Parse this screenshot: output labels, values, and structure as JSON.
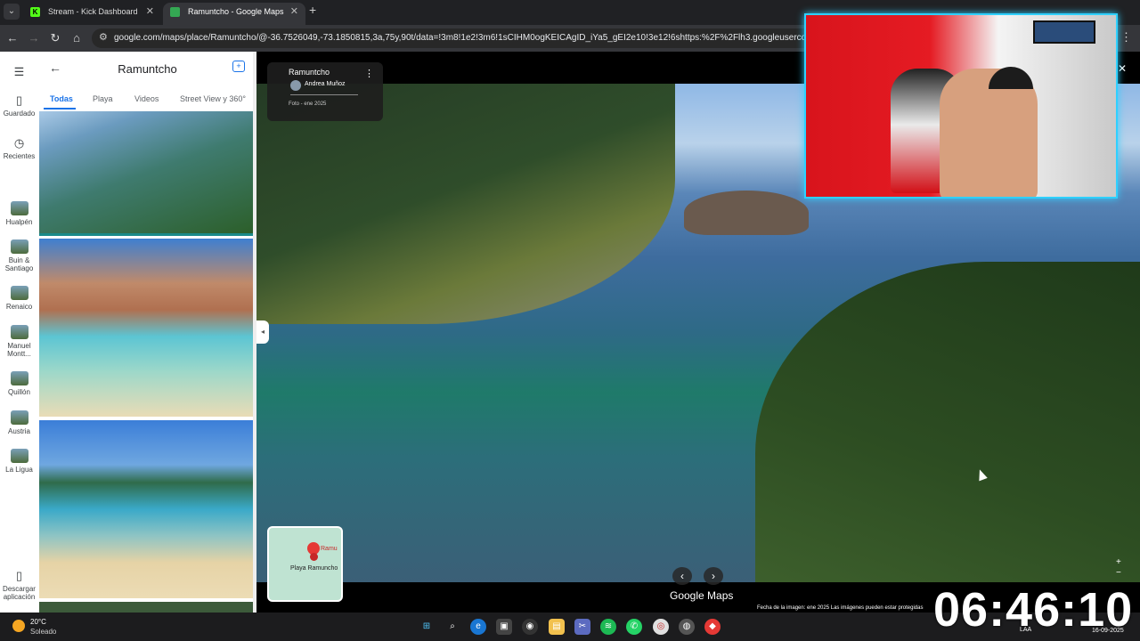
{
  "browser": {
    "tabs": [
      {
        "title": "Stream - Kick Dashboard",
        "favicon": "K"
      },
      {
        "title": "Ramuntcho - Google Maps",
        "favicon": "G"
      }
    ],
    "url": "google.com/maps/place/Ramuntcho/@-36.7526049,-73.1850815,3a,75y,90t/data=!3m8!1e2!3m6!1sCIHM0ogKEICAgID_iYa5_gEI2e10!3e12!6shttps:%2F%2Flh3.googleusercontent.com%2Fg"
  },
  "rail": {
    "saved": "Guardado",
    "recents": "Recientes",
    "places": [
      "Hualpén",
      "Buin & Santiago",
      "Renaico",
      "Manuel Montt...",
      "Quillón",
      "Austria",
      "La Ligua"
    ],
    "download": "Descargar aplicación"
  },
  "panel": {
    "title": "Ramuntcho",
    "tabs": [
      "Todas",
      "Playa",
      "Videos",
      "Street View y 360°"
    ]
  },
  "photo_info": {
    "title": "Ramuntcho",
    "author": "Andrea Muñoz",
    "date": "Foto - ene 2025"
  },
  "minimap": {
    "label": "Playa Ramuncho",
    "pin_label": "Ramu"
  },
  "viewer": {
    "brand": "Google Maps",
    "credits": "Fecha de la imagen: ene 2025     Las imágenes pueden estar protegidas"
  },
  "overlay": {
    "clock": "06:46:10"
  },
  "taskbar": {
    "temp": "20°C",
    "weather": "Soleado",
    "lang": "LAA",
    "date": "16-09-2025"
  }
}
